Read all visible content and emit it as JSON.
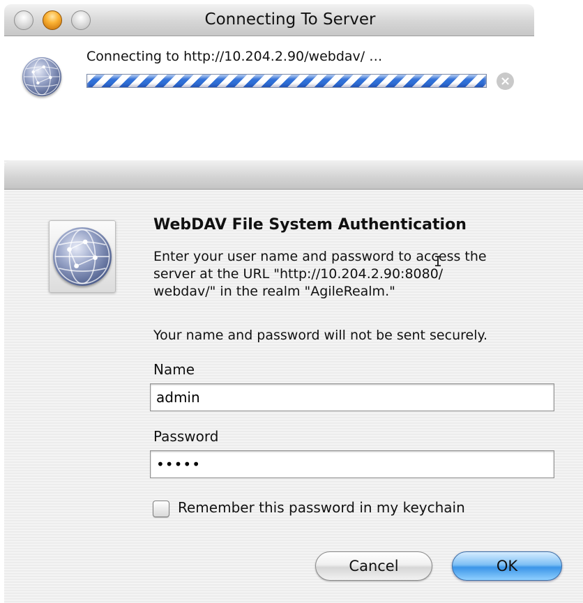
{
  "connecting_window": {
    "title": "Connecting To Server",
    "status_text": "Connecting to http://10.204.2.90/webdav/ …"
  },
  "auth_dialog": {
    "heading": "WebDAV File System Authentication",
    "message_lines": [
      "Enter your user name and password to access the",
      "server at the URL \"http://10.204.2.90:8080/",
      "webdav/\" in the realm \"AgileRealm.\""
    ],
    "warning": "Your name and password will not be sent securely.",
    "name_label": "Name",
    "name_value": "admin",
    "password_label": "Password",
    "password_value": "•••••",
    "remember_label": "Remember this password in my keychain",
    "remember_checked": false,
    "cancel_label": "Cancel",
    "ok_label": "OK"
  },
  "icons": {
    "close": "close-traffic-light-icon",
    "minimize": "minimize-traffic-light-icon",
    "zoom": "zoom-traffic-light-icon",
    "network": "network-globe-icon",
    "stop": "stop-circle-x-icon",
    "cursor": "ibeam-cursor-icon"
  },
  "colors": {
    "progress_stripe": "#2f6fd7",
    "default_button": "#3b95e8",
    "minimize_light": "#fbb335"
  }
}
